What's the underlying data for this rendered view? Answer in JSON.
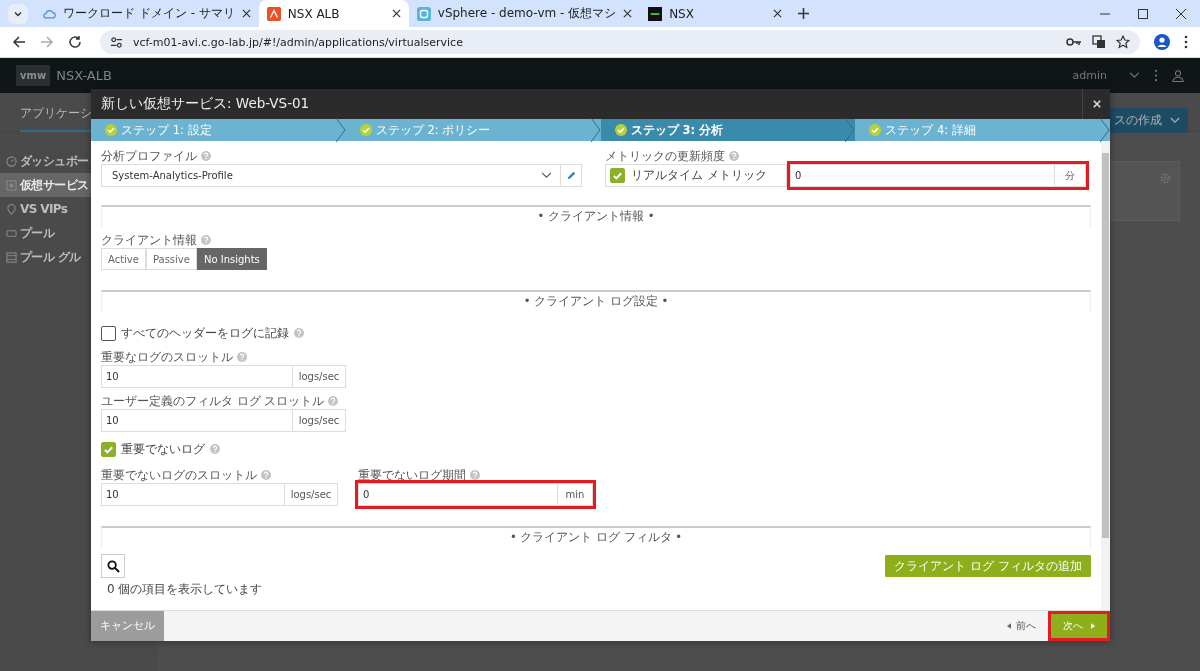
{
  "browser": {
    "tabs": [
      {
        "title": "ワークロード ドメイン - サマリ",
        "selected": false
      },
      {
        "title": "NSX ALB",
        "selected": true
      },
      {
        "title": "vSphere - demo-vm - 仮想マシ",
        "selected": false
      },
      {
        "title": "NSX",
        "selected": false
      }
    ],
    "url": "vcf-m01-avi.c.go-lab.jp/#!/admin/applications/virtualservice"
  },
  "app": {
    "logo": "vmw",
    "brand": "NSX-ALB",
    "user": "admin",
    "subnav_tab": "アプリケーシ",
    "create_button": "スの作成",
    "sidebar": {
      "items": [
        {
          "label": "ダッシュボー",
          "selected": false
        },
        {
          "label": "仮想サービス",
          "selected": true
        },
        {
          "label": "VS VIPs",
          "selected": false
        },
        {
          "label": "プール",
          "selected": false
        },
        {
          "label": "プール グル",
          "selected": false
        }
      ]
    }
  },
  "modal": {
    "title": "新しい仮想サービス: Web-VS-01",
    "steps": [
      {
        "label": "ステップ 1: 設定",
        "done": true,
        "selected": false
      },
      {
        "label": "ステップ 2: ポリシー",
        "done": true,
        "selected": false
      },
      {
        "label": "ステップ 3: 分析",
        "done": true,
        "selected": true
      },
      {
        "label": "ステップ 4: 詳細",
        "done": true,
        "selected": false
      }
    ],
    "analytics_profile": {
      "label": "分析プロファイル",
      "value": "System-Analytics-Profile"
    },
    "metric_update": {
      "label": "メトリックの更新頻度",
      "realtime_label": "リアルタイム メトリック",
      "checked": true,
      "value": "0",
      "unit": "分",
      "highlighted": true
    },
    "client_info_heading": "• クライアント情報 •",
    "client_insights": {
      "label": "クライアント情報",
      "options": [
        {
          "label": "Active",
          "selected": false
        },
        {
          "label": "Passive",
          "selected": false
        },
        {
          "label": "No Insights",
          "selected": true
        }
      ]
    },
    "client_log_heading": "• クライアント ログ設定 •",
    "log_all_headers": {
      "label": "すべてのヘッダーをログに記録",
      "checked": false
    },
    "significant_log_throttle": {
      "label": "重要なログのスロットル",
      "value": "10",
      "unit": "logs/sec",
      "highlighted": false
    },
    "filtered_log_throttle": {
      "label": "ユーザー定義のフィルタ ログ スロットル",
      "value": "10",
      "unit": "logs/sec",
      "highlighted": false
    },
    "non_significant_logs": {
      "label": "重要でないログ",
      "checked": true
    },
    "non_significant_log_throttle": {
      "label": "重要でないログのスロットル",
      "value": "10",
      "unit": "logs/sec",
      "highlighted": false
    },
    "non_significant_log_duration": {
      "label": "重要でないログ期間",
      "value": "0",
      "unit": "min",
      "highlighted": true
    },
    "log_filter_heading": "• クライアント ログ フィルタ •",
    "add_filter_button": "クライアント ログ フィルタの追加",
    "item_count": "0 個の項目を表示しています",
    "footer": {
      "cancel": "キャンセル",
      "previous": "前へ",
      "next": "次へ",
      "next_highlighted": true
    }
  }
}
